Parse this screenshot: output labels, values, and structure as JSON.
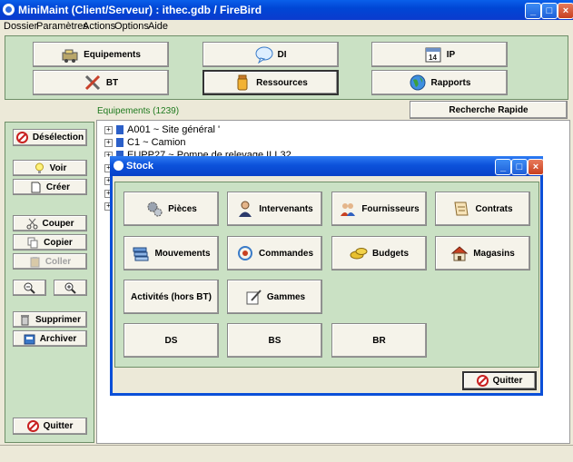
{
  "window": {
    "title": "MiniMaint (Client/Serveur) : ithec.gdb / FireBird"
  },
  "menu": [
    "Dossier",
    "Paramètres",
    "Actions",
    "Options",
    "Aide"
  ],
  "topButtons": {
    "equipements": "Equipements",
    "di": "DI",
    "ip": "IP",
    "bt": "BT",
    "ressources": "Ressources",
    "rapports": "Rapports"
  },
  "equipCount": "Equipements (1239)",
  "rechercheRapide": "Recherche Rapide",
  "sideButtons": {
    "deselection": "Désélection",
    "voir": "Voir",
    "creer": "Créer",
    "couper": "Couper",
    "copier": "Copier",
    "coller": "Coller",
    "supprimer": "Supprimer",
    "archiver": "Archiver",
    "quitter": "Quitter"
  },
  "tree": [
    {
      "code": "A001",
      "label": "A001 ~ Site général '"
    },
    {
      "code": "C1",
      "label": "C1 ~ Camion"
    },
    {
      "code": "EUPP27",
      "label": "EUPP27 ~ Pompe de relevage ILL32"
    }
  ],
  "stock": {
    "title": "Stock",
    "buttons": {
      "pieces": "Pièces",
      "intervenants": "Intervenants",
      "fournisseurs": "Fournisseurs",
      "contrats": "Contrats",
      "mouvements": "Mouvements",
      "commandes": "Commandes",
      "budgets": "Budgets",
      "magasins": "Magasins",
      "activites": "Activités (hors BT)",
      "gammes": "Gammes",
      "ds": "DS",
      "bs": "BS",
      "br": "BR"
    },
    "quitter": "Quitter"
  },
  "colors": {
    "panel": "#CAE1C4",
    "titlebar": "#0046D5",
    "face": "#ECE9D8"
  }
}
